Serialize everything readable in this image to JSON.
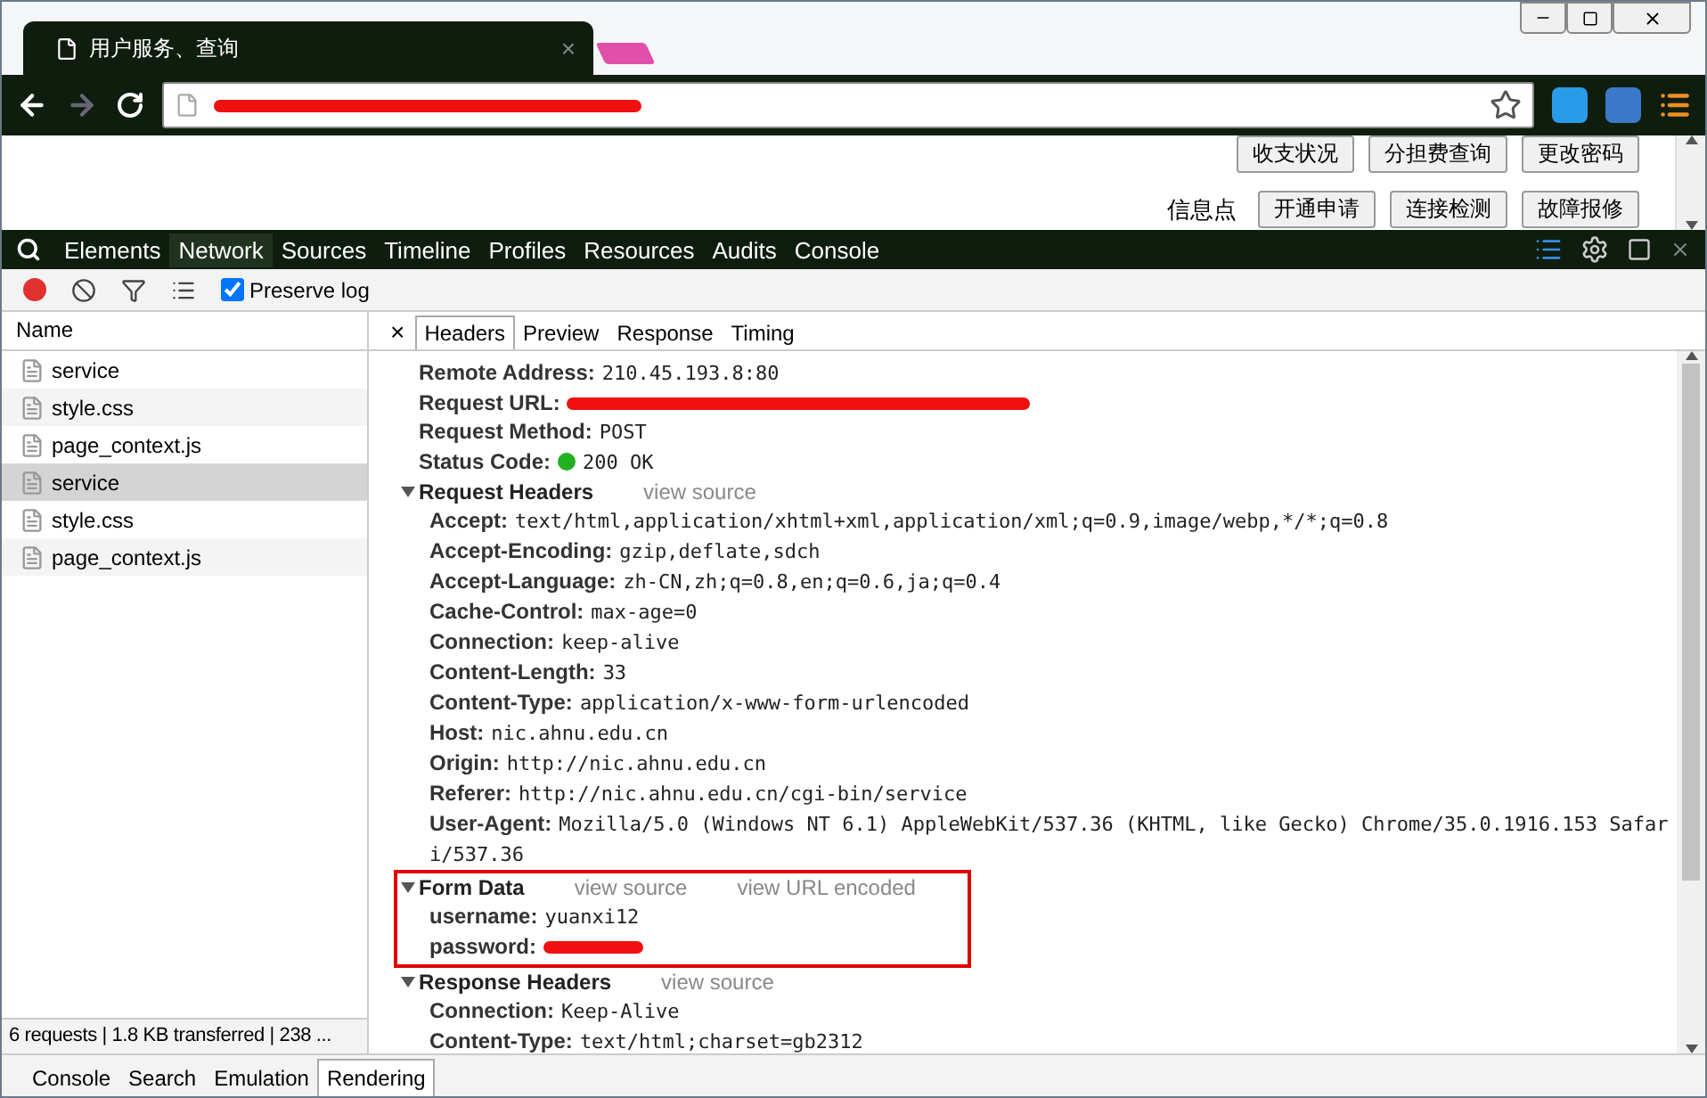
{
  "browser_tab": {
    "title": "用户服务、查询",
    "close": "×"
  },
  "page": {
    "row1": [
      "收支状况",
      "分担费查询",
      "更改密码"
    ],
    "row2_label": "信息点",
    "row2": [
      "开通申请",
      "连接检测",
      "故障报修"
    ]
  },
  "devtools_tabs": [
    {
      "label": "Elements",
      "selected": false
    },
    {
      "label": "Network",
      "selected": true
    },
    {
      "label": "Sources",
      "selected": false
    },
    {
      "label": "Timeline",
      "selected": false
    },
    {
      "label": "Profiles",
      "selected": false
    },
    {
      "label": "Resources",
      "selected": false
    },
    {
      "label": "Audits",
      "selected": false
    },
    {
      "label": "Console",
      "selected": false
    }
  ],
  "network_toolbar": {
    "recording": true,
    "preserve_log": {
      "label": "Preserve log",
      "checked": true
    }
  },
  "requests": {
    "header": "Name",
    "items": [
      {
        "name": "service",
        "selected": false
      },
      {
        "name": "style.css",
        "selected": false
      },
      {
        "name": "page_context.js",
        "selected": false
      },
      {
        "name": "service",
        "selected": true
      },
      {
        "name": "style.css",
        "selected": false
      },
      {
        "name": "page_context.js",
        "selected": false
      }
    ],
    "summary": "6 requests | 1.8 KB transferred | 238 ..."
  },
  "detail_tabs": {
    "close": "×",
    "tabs": [
      {
        "label": "Headers",
        "selected": true
      },
      {
        "label": "Preview",
        "selected": false
      },
      {
        "label": "Response",
        "selected": false
      },
      {
        "label": "Timing",
        "selected": false
      }
    ]
  },
  "general": [
    {
      "key": "Remote Address:",
      "value": "210.45.193.8:80"
    },
    {
      "key": "Request URL:",
      "redacted": true
    },
    {
      "key": "Request Method:",
      "value": "POST"
    },
    {
      "key": "Status Code:",
      "value": "200 OK",
      "color": "#22b022"
    }
  ],
  "sections": [
    {
      "title": "Request Headers",
      "expanded": true,
      "highlighted": false,
      "links": [
        "view source"
      ],
      "rows": [
        {
          "key": "Accept:",
          "value": "text/html,application/xhtml+xml,application/xml;q=0.9,image/webp,*/*;q=0.8"
        },
        {
          "key": "Accept-Encoding:",
          "value": "gzip,deflate,sdch"
        },
        {
          "key": "Accept-Language:",
          "value": "zh-CN,zh;q=0.8,en;q=0.6,ja;q=0.4"
        },
        {
          "key": "Cache-Control:",
          "value": "max-age=0"
        },
        {
          "key": "Connection:",
          "value": "keep-alive"
        },
        {
          "key": "Content-Length:",
          "value": "33"
        },
        {
          "key": "Content-Type:",
          "value": "application/x-www-form-urlencoded"
        },
        {
          "key": "Host:",
          "value": "nic.ahnu.edu.cn"
        },
        {
          "key": "Origin:",
          "value": "http://nic.ahnu.edu.cn"
        },
        {
          "key": "Referer:",
          "value": "http://nic.ahnu.edu.cn/cgi-bin/service"
        },
        {
          "key": "User-Agent:",
          "value": "Mozilla/5.0 (Windows NT 6.1) AppleWebKit/537.36 (KHTML, like Gecko) Chrome/35.0.1916.153 Safari/537.36"
        }
      ]
    },
    {
      "title": "Form Data",
      "expanded": true,
      "highlighted": true,
      "links": [
        "view source",
        "view URL encoded"
      ],
      "rows": [
        {
          "key": "username:",
          "value": "yuanxi12"
        },
        {
          "key": "password:",
          "redacted": true
        }
      ]
    },
    {
      "title": "Response Headers",
      "expanded": true,
      "highlighted": false,
      "links": [
        "view source"
      ],
      "rows": [
        {
          "key": "Connection:",
          "value": "Keep-Alive"
        },
        {
          "key": "Content-Type:",
          "value": "text/html;charset=gb2312"
        }
      ]
    }
  ],
  "drawer_tabs": [
    {
      "label": "Console",
      "selected": false
    },
    {
      "label": "Search",
      "selected": false
    },
    {
      "label": "Emulation",
      "selected": false
    },
    {
      "label": "Rendering",
      "selected": true
    }
  ]
}
